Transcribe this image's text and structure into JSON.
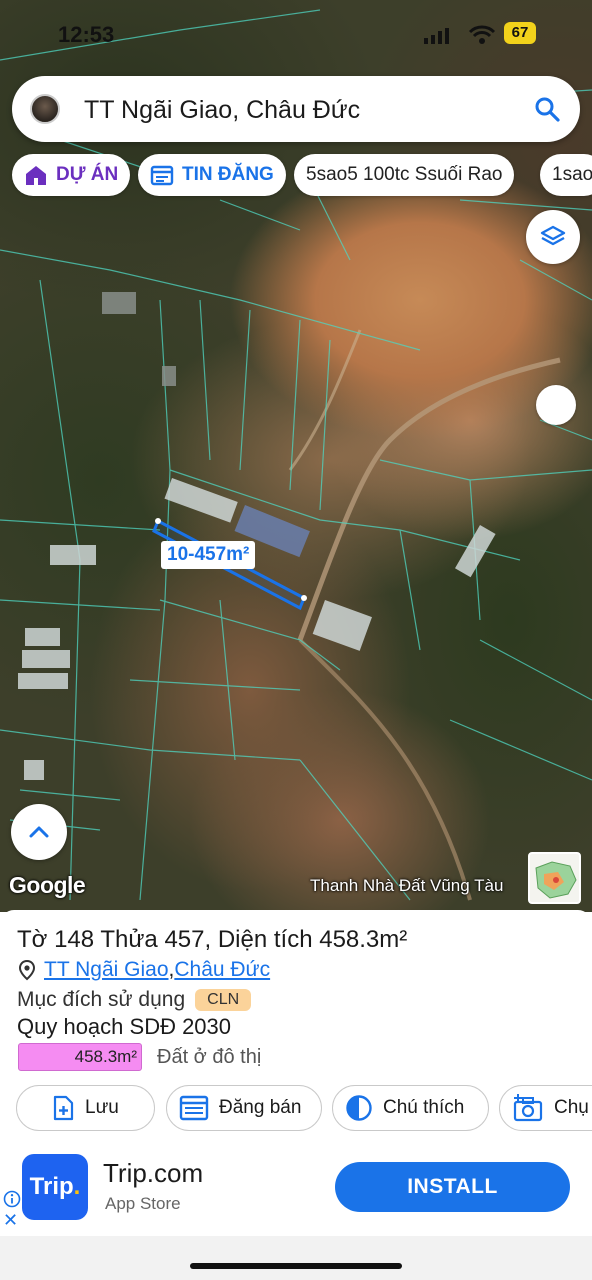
{
  "status_bar": {
    "time": "12:53",
    "battery": "67"
  },
  "search": {
    "title": "TT Ngãi Giao, Châu Đức",
    "icon": "search-icon"
  },
  "chips": [
    {
      "label": "DỰ ÁN",
      "icon": "house-icon"
    },
    {
      "label": "TIN ĐĂNG",
      "icon": "calendar-list-icon"
    },
    {
      "label": "5sao5 100tc Ssuối Rao"
    },
    {
      "label": "1sao"
    }
  ],
  "map": {
    "parcel_label": "10-457m²",
    "logo": "Google",
    "credit": "Thanh Nhà Đất Vũng Tàu"
  },
  "parcel_info": {
    "title_prefix": "Tờ ",
    "sheet": "148",
    "plot_prefix": " Thửa ",
    "plot": "457",
    "area_prefix": ", Diện tích ",
    "area": "458.3m²",
    "location_town": "TT Ngãi Giao",
    "location_sep": ", ",
    "location_district": "Châu Đức",
    "purpose_label": "Mục đích sử dụng",
    "purpose_code": "CLN",
    "plan_label": "Quy hoạch SDĐ 2030",
    "plan_area": "458.3m²",
    "plan_type": "Đất ở đô thị",
    "plan_color": "#f58cf2"
  },
  "actions": [
    {
      "label": "Lưu",
      "icon": "save-plus-icon"
    },
    {
      "label": "Đăng bán",
      "icon": "listing-icon"
    },
    {
      "label": "Chú thích",
      "icon": "half-circle-icon"
    },
    {
      "label": "Chụ",
      "icon": "camera-icon"
    }
  ],
  "ad": {
    "logo_text": "Trip",
    "logo_dot": ".",
    "name": "Trip.com",
    "store": "App Store",
    "install": "INSTALL"
  },
  "colors": {
    "accent": "#1a73e8",
    "chip_purple": "#6b2fbf",
    "purpose_badge": "#fbd39a"
  }
}
